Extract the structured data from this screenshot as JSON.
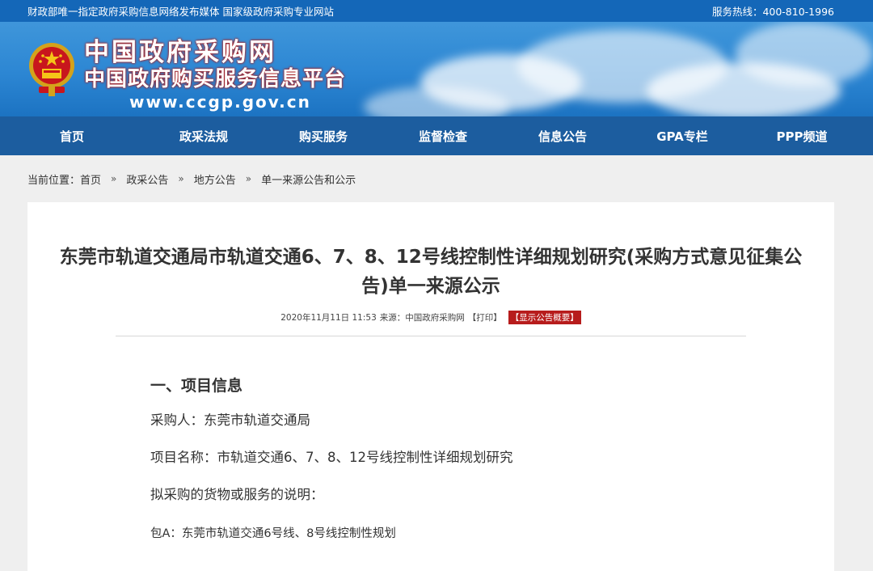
{
  "topbar": {
    "left_text": "财政部唯一指定政府采购信息网络发布媒体  国家级政府采购专业网站",
    "hotline": "服务热线：400-810-1996"
  },
  "banner": {
    "site_name": "中国政府采购网",
    "site_subtitle": "中国政府购买服务信息平台",
    "url": "www.ccgp.gov.cn"
  },
  "nav": {
    "items": [
      "首页",
      "政采法规",
      "购买服务",
      "监督检查",
      "信息公告",
      "GPA专栏",
      "PPP频道"
    ]
  },
  "breadcrumb": {
    "label": "当前位置：",
    "items": [
      "首页",
      "政采公告",
      "地方公告",
      "单一来源公告和公示"
    ],
    "separator": "»"
  },
  "article": {
    "title": "东莞市轨道交通局市轨道交通6、7、8、12号线控制性详细规划研究(采购方式意见征集公告)单一来源公示",
    "meta": {
      "date": "2020年11月11日 11:53",
      "source": "来源：中国政府采购网",
      "print": "【打印】",
      "summary": "【显示公告概要】"
    },
    "section_title": "一、项目信息",
    "purchaser": "采购人：东莞市轨道交通局",
    "project_name": "项目名称：市轨道交通6、7、8、12号线控制性详细规划研究",
    "goods_desc": "拟采购的货物或服务的说明：",
    "package_a": "包A：东莞市轨道交通6号线、8号线控制性规划"
  },
  "colors": {
    "topbar": "#1467b8",
    "nav": "#1c5d9f",
    "summary_badge": "#b71c1c"
  }
}
